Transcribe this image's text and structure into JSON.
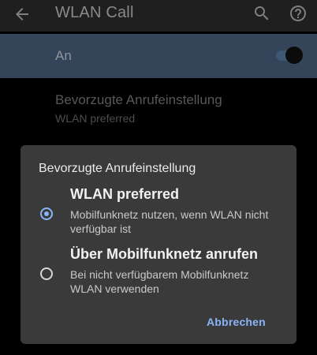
{
  "app_bar": {
    "title": "WLAN Call",
    "back_icon": "arrow-back-icon",
    "search_icon": "search-icon",
    "help_icon": "help-icon"
  },
  "master_switch": {
    "label": "An",
    "checked": true
  },
  "preference": {
    "title": "Bevorzugte Anrufeinstellung",
    "summary": "WLAN preferred"
  },
  "dialog": {
    "title": "Bevorzugte Anrufeinstellung",
    "options": [
      {
        "title": "WLAN preferred",
        "description": "Mobilfunknetz nutzen, wenn WLAN nicht verfügbar ist",
        "selected": true
      },
      {
        "title": "Über Mobilfunknetz anrufen",
        "description": "Bei nicht verfügbarem Mobilfunknetz WLAN verwenden",
        "selected": false
      }
    ],
    "cancel_label": "Abbrechen"
  },
  "colors": {
    "accent": "#8ab4f8",
    "switch_row_bg": "#344459",
    "dialog_bg": "#3a3a3b"
  }
}
